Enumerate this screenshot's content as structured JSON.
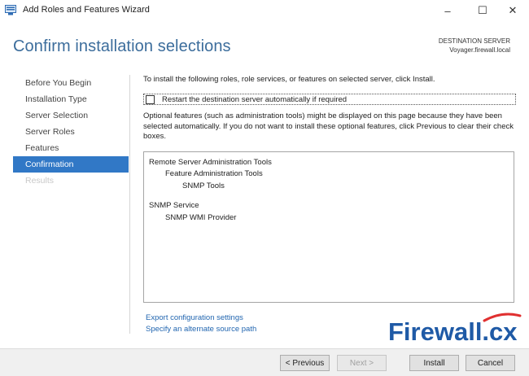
{
  "window": {
    "title": "Add Roles and Features Wizard",
    "controls": {
      "minimize": "–",
      "maximize": "☐",
      "close": "✕"
    }
  },
  "header": {
    "heading": "Confirm installation selections",
    "destination_label": "DESTINATION SERVER",
    "destination_server": "Voyager.firewall.local"
  },
  "nav": {
    "items": [
      {
        "label": "Before You Begin",
        "state": "normal"
      },
      {
        "label": "Installation Type",
        "state": "normal"
      },
      {
        "label": "Server Selection",
        "state": "normal"
      },
      {
        "label": "Server Roles",
        "state": "normal"
      },
      {
        "label": "Features",
        "state": "normal"
      },
      {
        "label": "Confirmation",
        "state": "active"
      },
      {
        "label": "Results",
        "state": "disabled"
      }
    ]
  },
  "content": {
    "intro": "To install the following roles, role services, or features on selected server, click Install.",
    "restart_label": "Restart the destination server automatically if required",
    "restart_checked": false,
    "optional_note": "Optional features (such as administration tools) might be displayed on this page because they have been selected automatically. If you do not want to install these optional features, click Previous to clear their check boxes.",
    "features": [
      {
        "label": "Remote Server Administration Tools",
        "level": 0
      },
      {
        "label": "Feature Administration Tools",
        "level": 1
      },
      {
        "label": "SNMP Tools",
        "level": 2
      },
      {
        "label": "SNMP Service",
        "level": 0
      },
      {
        "label": "SNMP WMI Provider",
        "level": 1
      }
    ],
    "links": {
      "export": "Export configuration settings",
      "source": "Specify an alternate source path"
    }
  },
  "logo": {
    "text": "Firewall.cx"
  },
  "buttons": {
    "previous": "< Previous",
    "next": "Next >",
    "install": "Install",
    "cancel": "Cancel"
  },
  "colors": {
    "accent": "#3178c6",
    "heading": "#3c6d9c",
    "link": "#2266b0",
    "logo": "#1f5aa6",
    "logo_swoosh": "#e03030"
  }
}
